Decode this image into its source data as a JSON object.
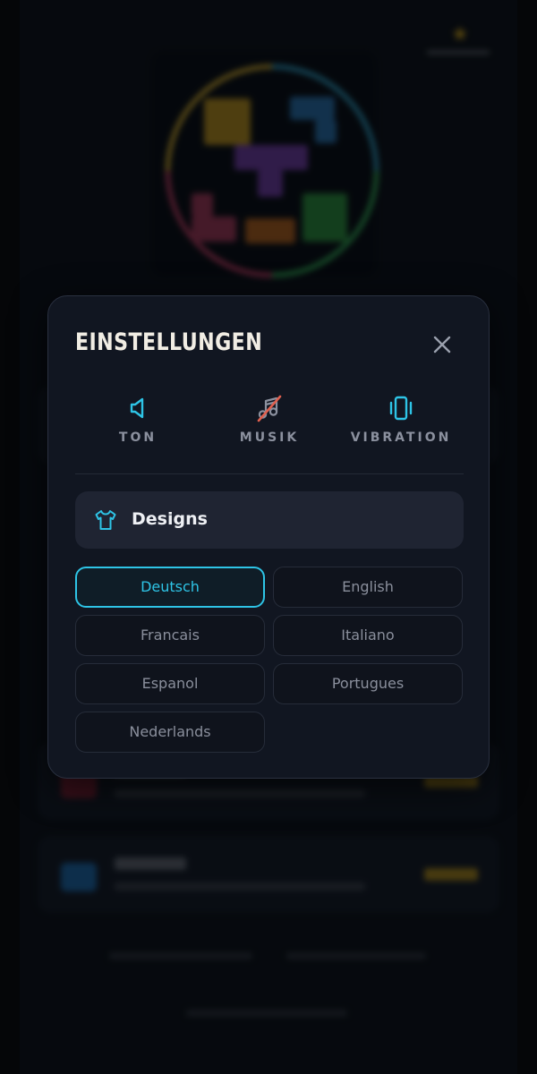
{
  "settings": {
    "title": "EINSTELLUNGEN",
    "close_icon": "close-icon",
    "toggles": [
      {
        "key": "sound",
        "label": "TON",
        "icon": "speaker-icon",
        "enabled": true,
        "color": "#2ec4e6"
      },
      {
        "key": "music",
        "label": "MUSIK",
        "icon": "music-off-icon",
        "enabled": false,
        "color": "#e0604f"
      },
      {
        "key": "vibration",
        "label": "VIBRATION",
        "icon": "vibration-icon",
        "enabled": true,
        "color": "#2ec4e6"
      }
    ],
    "designs": {
      "label": "Designs",
      "icon": "tshirt-icon"
    },
    "languages": [
      {
        "label": "Deutsch",
        "selected": true
      },
      {
        "label": "English",
        "selected": false
      },
      {
        "label": "Francais",
        "selected": false
      },
      {
        "label": "Italiano",
        "selected": false
      },
      {
        "label": "Espanol",
        "selected": false
      },
      {
        "label": "Portugues",
        "selected": false
      },
      {
        "label": "Nederlands",
        "selected": false
      }
    ]
  },
  "colors": {
    "accent": "#2ec4e6",
    "muted_off": "#e0604f",
    "modal_bg": "#111621",
    "background": "#0c0f15",
    "gold": "#e8b417"
  }
}
